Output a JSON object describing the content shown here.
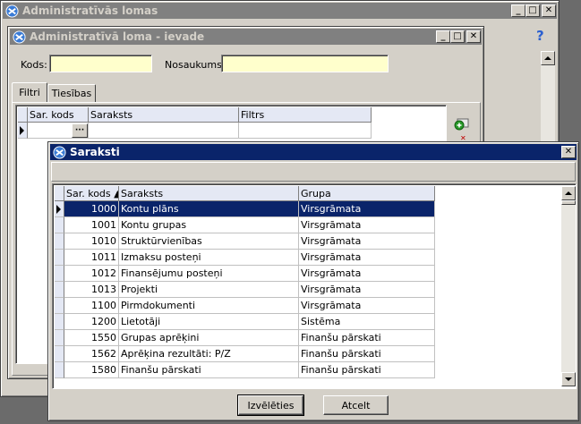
{
  "bg_window": {
    "title": "Administratīvās lomas",
    "help_icon": "question-icon"
  },
  "entry_window": {
    "title": "Administratīvā loma - ievade",
    "kods_label": "Kods:",
    "kods_value": "",
    "nosaukums_label": "Nosaukums:",
    "nosaukums_value": "",
    "tabs": [
      {
        "label": "Filtri",
        "active": true
      },
      {
        "label": "Tiesības",
        "active": false
      }
    ],
    "grid": {
      "headers": [
        "Sar. kods",
        "Saraksts",
        "Filtrs"
      ],
      "ellipsis": "···"
    }
  },
  "dialog": {
    "title": "Saraksti",
    "columns": [
      "Sar. kods ▲",
      "Saraksts",
      "Grupa"
    ],
    "rows": [
      {
        "code": "1000",
        "name": "Kontu plāns",
        "group": "Virsgrāmata",
        "selected": true
      },
      {
        "code": "1001",
        "name": "Kontu grupas",
        "group": "Virsgrāmata"
      },
      {
        "code": "1010",
        "name": "Struktūrvienības",
        "group": "Virsgrāmata"
      },
      {
        "code": "1011",
        "name": "Izmaksu posteņi",
        "group": "Virsgrāmata"
      },
      {
        "code": "1012",
        "name": "Finansējumu posteņi",
        "group": "Virsgrāmata"
      },
      {
        "code": "1013",
        "name": "Projekti",
        "group": "Virsgrāmata"
      },
      {
        "code": "1100",
        "name": "Pirmdokumenti",
        "group": "Virsgrāmata"
      },
      {
        "code": "1200",
        "name": "Lietotāji",
        "group": "Sistēma"
      },
      {
        "code": "1550",
        "name": "Grupas aprēķini",
        "group": "Finanšu pārskati"
      },
      {
        "code": "1562",
        "name": "Aprēķina rezultāti: P/Z",
        "group": "Finanšu pārskati"
      },
      {
        "code": "1580",
        "name": "Finanšu pārskati",
        "group": "Finanšu pārskati"
      }
    ],
    "select_button": "Izvēlēties",
    "cancel_button": "Atcelt"
  },
  "colors": {
    "title_active": "#0a246a",
    "title_inactive": "#808080",
    "input_bg": "#ffffcc",
    "face": "#d4d0c8"
  }
}
